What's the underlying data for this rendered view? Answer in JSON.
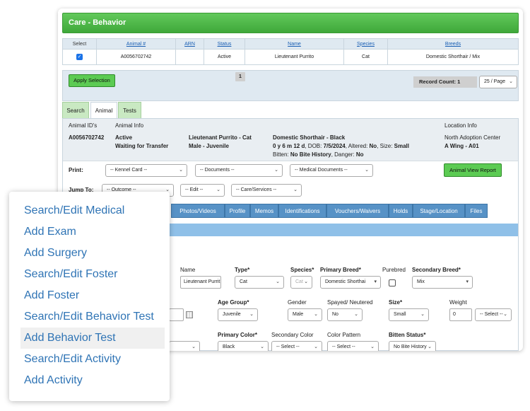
{
  "page": {
    "title": "Care - Behavior"
  },
  "grid": {
    "headers": [
      "Select",
      "Animal #",
      "ARN",
      "Status",
      "Name",
      "Species",
      "Breeds"
    ],
    "row": {
      "checked": "✓",
      "animal_no": "A0056702742",
      "arn": "",
      "status": "Active",
      "name": "Lieutenant Purrito",
      "species": "Cat",
      "breeds": "Domestic Shorthair / Mix"
    }
  },
  "pager": {
    "apply_label": "Apply Selection",
    "page": "1",
    "record_count": "Record Count: 1",
    "per_page": "25 / Page"
  },
  "tabs": [
    "Search",
    "Animal",
    "Tests"
  ],
  "animal_info": {
    "col1_header": "Animal ID's",
    "col2_header": "Animal Info",
    "location_header": "Location Info",
    "id": "A0056702742",
    "status1": "Active",
    "status2": "Waiting for Transfer",
    "name_species": "Lieutenant Purrito - Cat",
    "sex_age": "Male - Juvenile",
    "breed_color": "Domestic Shorthair - Black",
    "age_line_a": "0 y 6 m 12 d",
    "age_line_b": ", DOB: ",
    "dob": "7/5/2024",
    "altered_label": ", Altered: ",
    "altered": "No",
    "size_label": ", Size: ",
    "size": "Small",
    "bitten_label": "Bitten: ",
    "bitten": "No Bite History",
    "danger_label": ", Danger: ",
    "danger": "No",
    "location1": "North Adoption Center",
    "location2": "A Wing - A01"
  },
  "print": {
    "label": "Print:",
    "kennel": "-- Kennel Card --",
    "documents": "-- Documents --",
    "medical": "-- Medical Documents --",
    "report_label": "Animal View Report"
  },
  "jump": {
    "label": "Jump To:",
    "outcome": "-- Outcome --",
    "edit": "-- Edit --",
    "care": "-- Care/Services --"
  },
  "subtabs": [
    "Photos/Videos",
    "Profile",
    "Memos",
    "Identifications",
    "Vouchers/Waivers",
    "Holds",
    "Stage/Location",
    "Files"
  ],
  "form": {
    "name_label": "Name",
    "name_value": "Lieutenant Purrit",
    "type_label": "Type*",
    "type_value": "Cat",
    "species_label": "Species*",
    "species_value": "Cat",
    "primary_breed_label": "Primary Breed*",
    "primary_breed_value": "Domestic Shorthai",
    "purebred_label": "Purebred",
    "secondary_breed_label": "Secondary Breed*",
    "secondary_breed_value": "Mix",
    "age_group_label": "Age Group*",
    "age_group_value": "Juvenile",
    "gender_label": "Gender",
    "gender_value": "Male",
    "spayed_label": "Spayed/ Neutered",
    "spayed_value": "No",
    "size_label": "Size*",
    "size_value": "Small",
    "weight_label": "Weight",
    "weight_value": "0",
    "weight_unit": "-- Select --",
    "primary_color_label": "Primary Color*",
    "primary_color_value": "Black",
    "secondary_color_label": "Secondary Color",
    "secondary_color_value": "-- Select --",
    "color_pattern_label": "Color Pattern",
    "color_pattern_value": "-- Select --",
    "bitten_status_label": "Bitten Status*",
    "bitten_status_value": "No Bite History"
  },
  "menu": [
    "Search/Edit Medical",
    "Add Exam",
    "Add Surgery",
    "Search/Edit Foster",
    "Add Foster",
    "Search/Edit Behavior Test",
    "Add Behavior Test",
    "Search/Edit Activity",
    "Add Activity"
  ],
  "colors": {
    "title_green": "#4cb846",
    "tab_green": "#c9e9c2",
    "subtab_blue": "#5792c6",
    "menu_link": "#2f74b5"
  }
}
